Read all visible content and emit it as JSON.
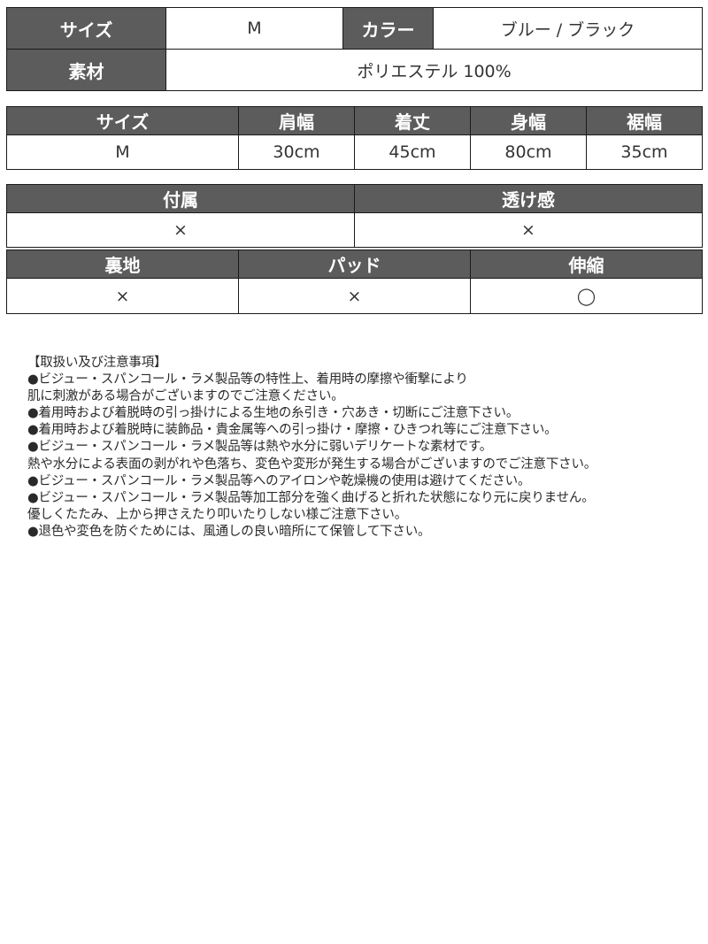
{
  "summary_table": {
    "size_label": "サイズ",
    "size_value": "M",
    "color_label": "カラー",
    "color_value": "ブルー / ブラック",
    "material_label": "素材",
    "material_value": "ポリエステル 100%"
  },
  "measurements_table": {
    "headers": [
      "サイズ",
      "肩幅",
      "着丈",
      "身幅",
      "裾幅"
    ],
    "rows": [
      [
        "M",
        "30cm",
        "45cm",
        "80cm",
        "35cm"
      ]
    ]
  },
  "features_table": {
    "row1": {
      "headers": [
        "付属",
        "透け感"
      ],
      "values": [
        "×",
        "×"
      ]
    },
    "row2": {
      "headers": [
        "裏地",
        "パッド",
        "伸縮"
      ],
      "values": [
        "×",
        "×",
        "◯"
      ]
    }
  },
  "care_notes": {
    "title": "【取扱い及び注意事項】",
    "lines": [
      "●ビジュー・スパンコール・ラメ製品等の特性上、着用時の摩擦や衝撃により",
      "肌に刺激がある場合がございますのでご注意ください。",
      "●着用時および着脱時の引っ掛けによる生地の糸引き・穴あき・切断にご注意下さい。",
      "●着用時および着脱時に装飾品・貴金属等への引っ掛け・摩擦・ひきつれ等にご注意下さい。",
      "●ビジュー・スパンコール・ラメ製品等は熱や水分に弱いデリケートな素材です。",
      "熱や水分による表面の剥がれや色落ち、変色や変形が発生する場合がございますのでご注意下さい。",
      "●ビジュー・スパンコール・ラメ製品等へのアイロンや乾燥機の使用は避けてください。",
      "●ビジュー・スパンコール・ラメ製品等加工部分を強く曲げると折れた状態になり元に戻りません。",
      "優しくたたみ、上から押さえたり叩いたりしない様ご注意下さい。",
      "●退色や変色を防ぐためには、風通しの良い暗所にて保管して下さい。"
    ]
  }
}
